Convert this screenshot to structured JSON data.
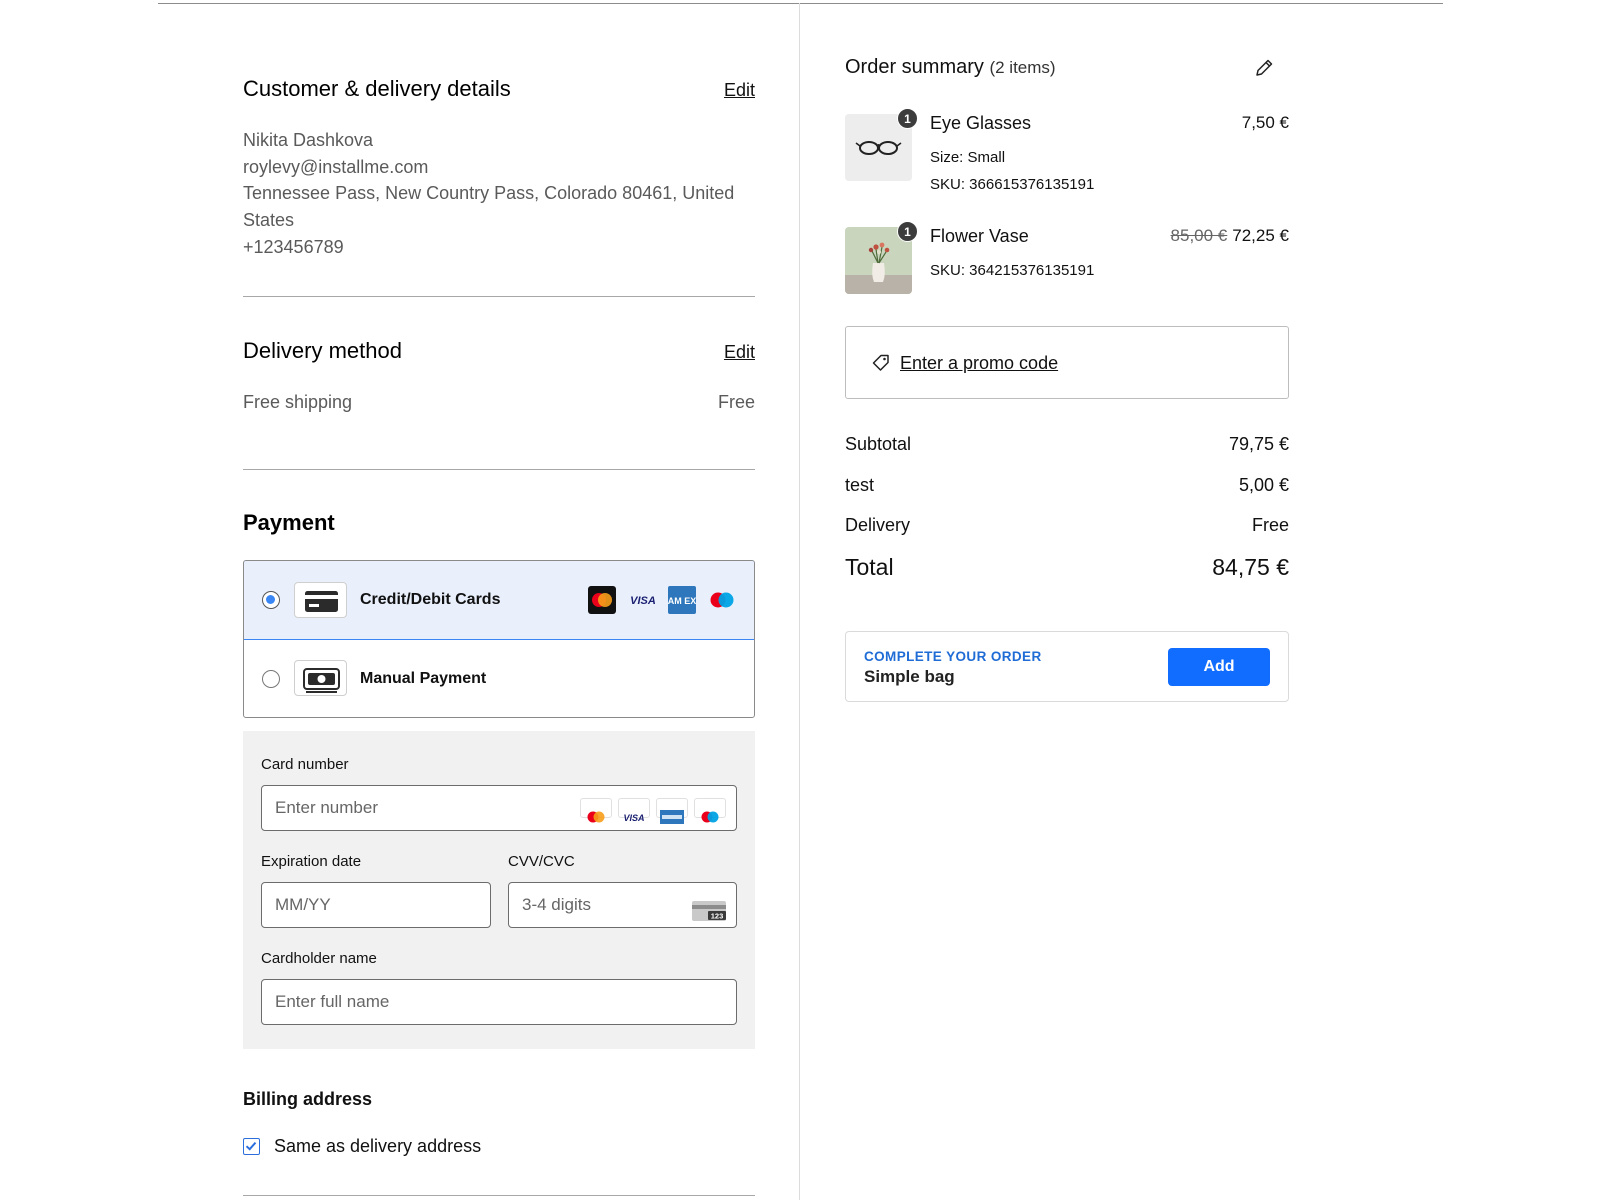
{
  "customer": {
    "title": "Customer & delivery details",
    "edit_label": "Edit",
    "name": "Nikita Dashkova",
    "email": "roylevy@installme.com",
    "address_line1": "Tennessee Pass, New Country Pass, Colorado 80461, United",
    "address_line2": "States",
    "phone": "+123456789"
  },
  "delivery": {
    "title": "Delivery method",
    "edit_label": "Edit",
    "method": "Free shipping",
    "price": "Free"
  },
  "payment": {
    "title": "Payment",
    "options": [
      {
        "label": "Credit/Debit Cards",
        "icon": "credit-card-icon",
        "selected": true,
        "brands": [
          "mastercard",
          "visa",
          "amex",
          "maestro"
        ]
      },
      {
        "label": "Manual Payment",
        "icon": "cash-icon",
        "selected": false
      }
    ],
    "form": {
      "card_number_label": "Card number",
      "card_number_placeholder": "Enter number",
      "expiration_label": "Expiration date",
      "expiration_placeholder": "MM/YY",
      "cvv_label": "CVV/CVC",
      "cvv_placeholder": "3-4 digits",
      "cvv_card_text": "123",
      "cardholder_label": "Cardholder name",
      "cardholder_placeholder": "Enter full name"
    },
    "brand_visa_text": "VISA",
    "brand_amex_text": "AM EX"
  },
  "billing": {
    "title": "Billing address",
    "same_as_delivery_label": "Same as delivery address",
    "same_as_delivery_checked": true
  },
  "summary": {
    "title": "Order summary",
    "count_label": "(2 items)",
    "items": [
      {
        "name": "Eye Glasses",
        "quantity": "1",
        "price": "7,50 €",
        "size": "Size: Small",
        "sku": "SKU: 366615376135191"
      },
      {
        "name": "Flower Vase",
        "quantity": "1",
        "old_price": "85,00 €",
        "price": "72,25 €",
        "sku": "SKU: 364215376135191"
      }
    ],
    "promo_label": "Enter a promo code",
    "subtotal_label": "Subtotal",
    "subtotal_value": "79,75 €",
    "fee_label": "test",
    "fee_value": "5,00 €",
    "delivery_label": "Delivery",
    "delivery_value": "Free",
    "total_label": "Total",
    "total_value": "84,75 €"
  },
  "upsell": {
    "eyebrow": "COMPLETE YOUR ORDER",
    "product": "Simple bag",
    "button_label": "Add"
  },
  "colors": {
    "accent": "#116dff",
    "selected_bg": "#e9f0fc",
    "eyebrow": "#1f6cd6"
  }
}
